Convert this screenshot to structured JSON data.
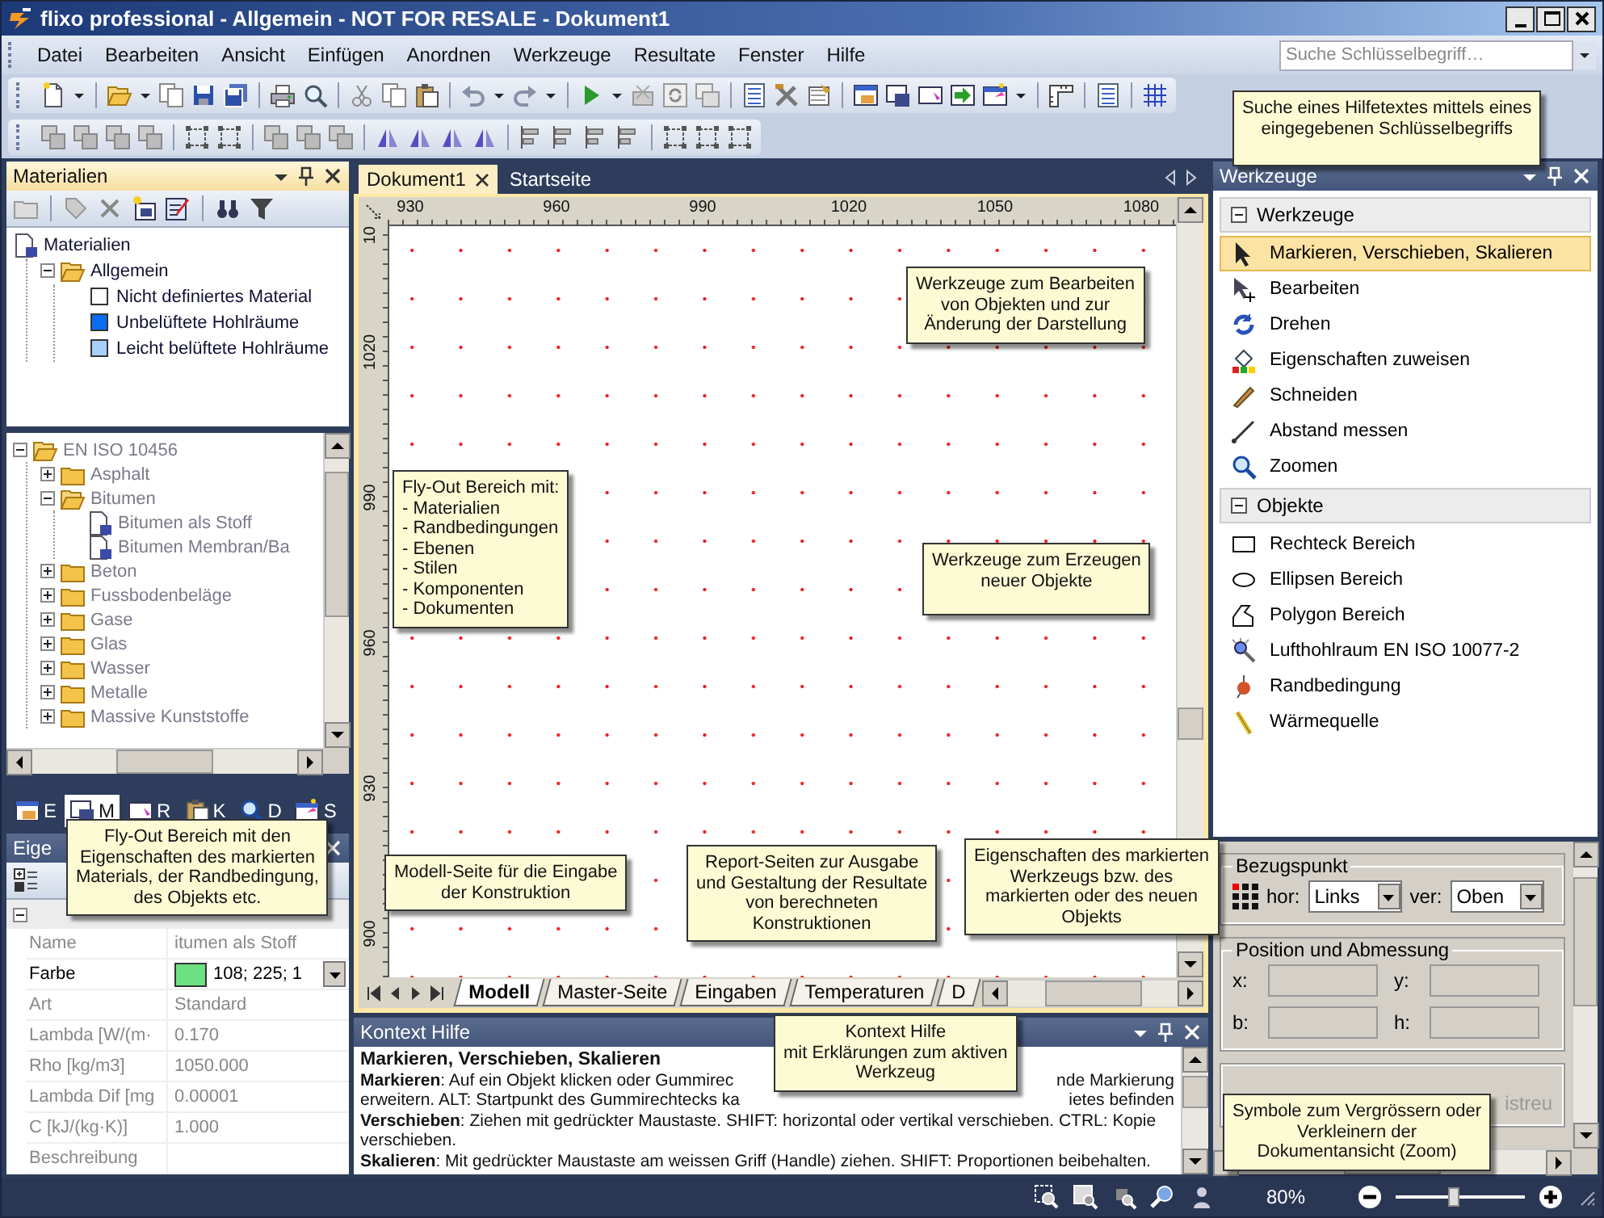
{
  "window": {
    "title": "flixo professional - Allgemein - NOT FOR RESALE - Dokument1"
  },
  "menu": [
    "Datei",
    "Bearbeiten",
    "Ansicht",
    "Einfügen",
    "Anordnen",
    "Werkzeuge",
    "Resultate",
    "Fenster",
    "Hilfe"
  ],
  "search": {
    "placeholder": "Suche Schlüsselbegriff…"
  },
  "materials_panel": {
    "title": "Materialien",
    "tree": [
      {
        "label": "Materialien",
        "kind": "root",
        "children": [
          {
            "label": "Allgemein",
            "kind": "folder",
            "expanded": true,
            "children": [
              {
                "label": "Nicht definiertes Material",
                "kind": "material",
                "color": "#ffffff"
              },
              {
                "label": "Unbelüftete Hohlräume",
                "kind": "material",
                "color": "#0a6cf0"
              },
              {
                "label": "Leicht belüftete Hohlräume",
                "kind": "material",
                "color": "#a6d0f8"
              }
            ]
          }
        ]
      }
    ]
  },
  "library_tree": [
    {
      "label": "EN ISO 10456",
      "kind": "folder",
      "expanded": true,
      "children": [
        {
          "label": "Asphalt",
          "kind": "folder",
          "expanded": false
        },
        {
          "label": "Bitumen",
          "kind": "folder",
          "expanded": true,
          "children": [
            {
              "label": "Bitumen als Stoff",
              "kind": "document"
            },
            {
              "label": "Bitumen Membran/Ba",
              "kind": "document"
            }
          ]
        },
        {
          "label": "Beton",
          "kind": "folder",
          "expanded": false
        },
        {
          "label": "Fussbodenbeläge",
          "kind": "folder",
          "expanded": false
        },
        {
          "label": "Gase",
          "kind": "folder",
          "expanded": false
        },
        {
          "label": "Glas",
          "kind": "folder",
          "expanded": false
        },
        {
          "label": "Wasser",
          "kind": "folder",
          "expanded": false
        },
        {
          "label": "Metalle",
          "kind": "folder",
          "expanded": false
        },
        {
          "label": "Massive Kunststoffe",
          "kind": "folder",
          "expanded": false
        }
      ]
    }
  ],
  "flyout_tabs": [
    {
      "label": "E",
      "selected": false
    },
    {
      "label": "M",
      "selected": true
    },
    {
      "label": "R",
      "selected": false
    },
    {
      "label": "K",
      "selected": false
    },
    {
      "label": "D",
      "selected": false
    },
    {
      "label": "S",
      "selected": false
    }
  ],
  "properties_panel": {
    "title": "Eige",
    "category": {
      "expanded": true
    },
    "rows": [
      {
        "name": "Name",
        "value": "itumen als Stoff",
        "selected": false
      },
      {
        "name": "Farbe",
        "value": "108; 225; 1",
        "kind": "color",
        "color": "#6ce182",
        "selected": true
      },
      {
        "name": "Art",
        "value": "Standard",
        "selected": false
      },
      {
        "name": "Lambda [W/(m·",
        "value": "0.170",
        "selected": false
      },
      {
        "name": "Rho [kg/m3]",
        "value": "1050.000",
        "selected": false
      },
      {
        "name": "Lambda Dif [mg",
        "value": "0.00001",
        "selected": false
      },
      {
        "name": "C [kJ/(kg·K)]",
        "value": "1.000",
        "selected": false
      },
      {
        "name": "Beschreibung",
        "selected": false
      }
    ]
  },
  "document_tabs": [
    {
      "label": "Dokument1",
      "selected": true
    },
    {
      "label": "Startseite",
      "selected": false
    }
  ],
  "canvas": {
    "x_ruler": [
      "930",
      "960",
      "990",
      "1020",
      "1050",
      "1080"
    ],
    "y_ruler": [
      "10",
      "1020",
      "990",
      "960",
      "930",
      "900"
    ]
  },
  "sheet_tabs": [
    {
      "label": "Modell",
      "selected": true
    },
    {
      "label": "Master-Seite",
      "selected": false
    },
    {
      "label": "Eingaben",
      "selected": false
    },
    {
      "label": "Temperaturen",
      "selected": false
    },
    {
      "label": "D",
      "selected": false
    }
  ],
  "context_help": {
    "title": "Kontext Hilfe",
    "heading": "Markieren, Verschieben, Skalieren",
    "lines": [
      {
        "text": "**Markieren**: Auf ein Objekt klicken oder Gummirec",
        "text_right": "nde Markierung"
      },
      {
        "text": "erweitern. ALT: Startpunkt des Gummirechtecks ka",
        "text_right": "ietes befinden"
      },
      {
        "text": "**Verschieben**: Ziehen mit gedrückter Maustaste. SHIFT: horizontal oder vertikal verschieben. CTRL: Kopie verschieben."
      },
      {
        "text": "**Skalieren**: Mit gedrückter Maustaste am weissen Griff (Handle) ziehen. SHIFT: Proportionen beibehalten."
      }
    ]
  },
  "tools_panel": {
    "title": "Werkzeuge",
    "groups": [
      {
        "title": "Werkzeuge",
        "expanded": true,
        "items": [
          {
            "label": "Markieren, Verschieben, Skalieren",
            "selected": true
          },
          {
            "label": "Bearbeiten",
            "selected": false
          },
          {
            "label": "Drehen",
            "selected": false
          },
          {
            "label": "Eigenschaften zuweisen",
            "selected": false
          },
          {
            "label": "Schneiden",
            "selected": false
          },
          {
            "label": "Abstand messen",
            "selected": false
          },
          {
            "label": "Zoomen",
            "selected": false
          }
        ]
      },
      {
        "title": "Objekte",
        "expanded": true,
        "items": [
          {
            "label": "Rechteck Bereich",
            "selected": false
          },
          {
            "label": "Ellipsen Bereich",
            "selected": false
          },
          {
            "label": "Polygon Bereich",
            "selected": false
          },
          {
            "label": "Lufthohlraum EN ISO 10077-2",
            "selected": false
          },
          {
            "label": "Randbedingung",
            "selected": false
          },
          {
            "label": "Wärmequelle",
            "selected": false
          }
        ]
      }
    ]
  },
  "object_properties": {
    "reference_point": {
      "title": "Bezugspunkt",
      "hor_label": "hor:",
      "hor_value": "Links",
      "ver_label": "ver:",
      "ver_value": "Oben"
    },
    "position": {
      "title": "Position und Abmessung",
      "fields": [
        "x:",
        "y:",
        "b:",
        "h:"
      ]
    },
    "group_3_text": "istreu"
  },
  "status_bar": {
    "zoom": "80%",
    "zoom_slider": {
      "level": 0.45
    }
  },
  "callouts": [
    {
      "text": "Suche eines Hilfetextes mittels eines\neingegebenen Schlüsselbegriffs"
    },
    {
      "text": "Werkzeuge zum Bearbeiten\nvon Objekten und zur\nÄnderung der Darstellung"
    },
    {
      "text": "Fly-Out Bereich mit:\n- Materialien\n- Randbedingungen\n- Ebenen\n- Stilen\n- Komponenten\n- Dokumenten",
      "kind": "list"
    },
    {
      "text": "Werkzeuge zum Erzeugen\nneuer Objekte"
    },
    {
      "text": "Fly-Out Bereich mit den\nEigenschaften des markierten\nMaterials, der Randbedingung,\ndes Objekts etc."
    },
    {
      "text": "Modell-Seite für die Eingabe\nder Konstruktion"
    },
    {
      "text": "Report-Seiten zur Ausgabe\nund Gestaltung der Resultate\nvon berechneten\nKonstruktionen"
    },
    {
      "text": "Eigenschaften des markierten\nWerkzeugs bzw. des\nmarkierten oder des neuen\nObjekts"
    },
    {
      "text": "Kontext Hilfe\nmit Erklärungen zum aktiven\nWerkzeug"
    },
    {
      "text": "Symbole zum Vergrössern oder\nVerkleinern der\nDokumentansicht (Zoom)"
    }
  ]
}
